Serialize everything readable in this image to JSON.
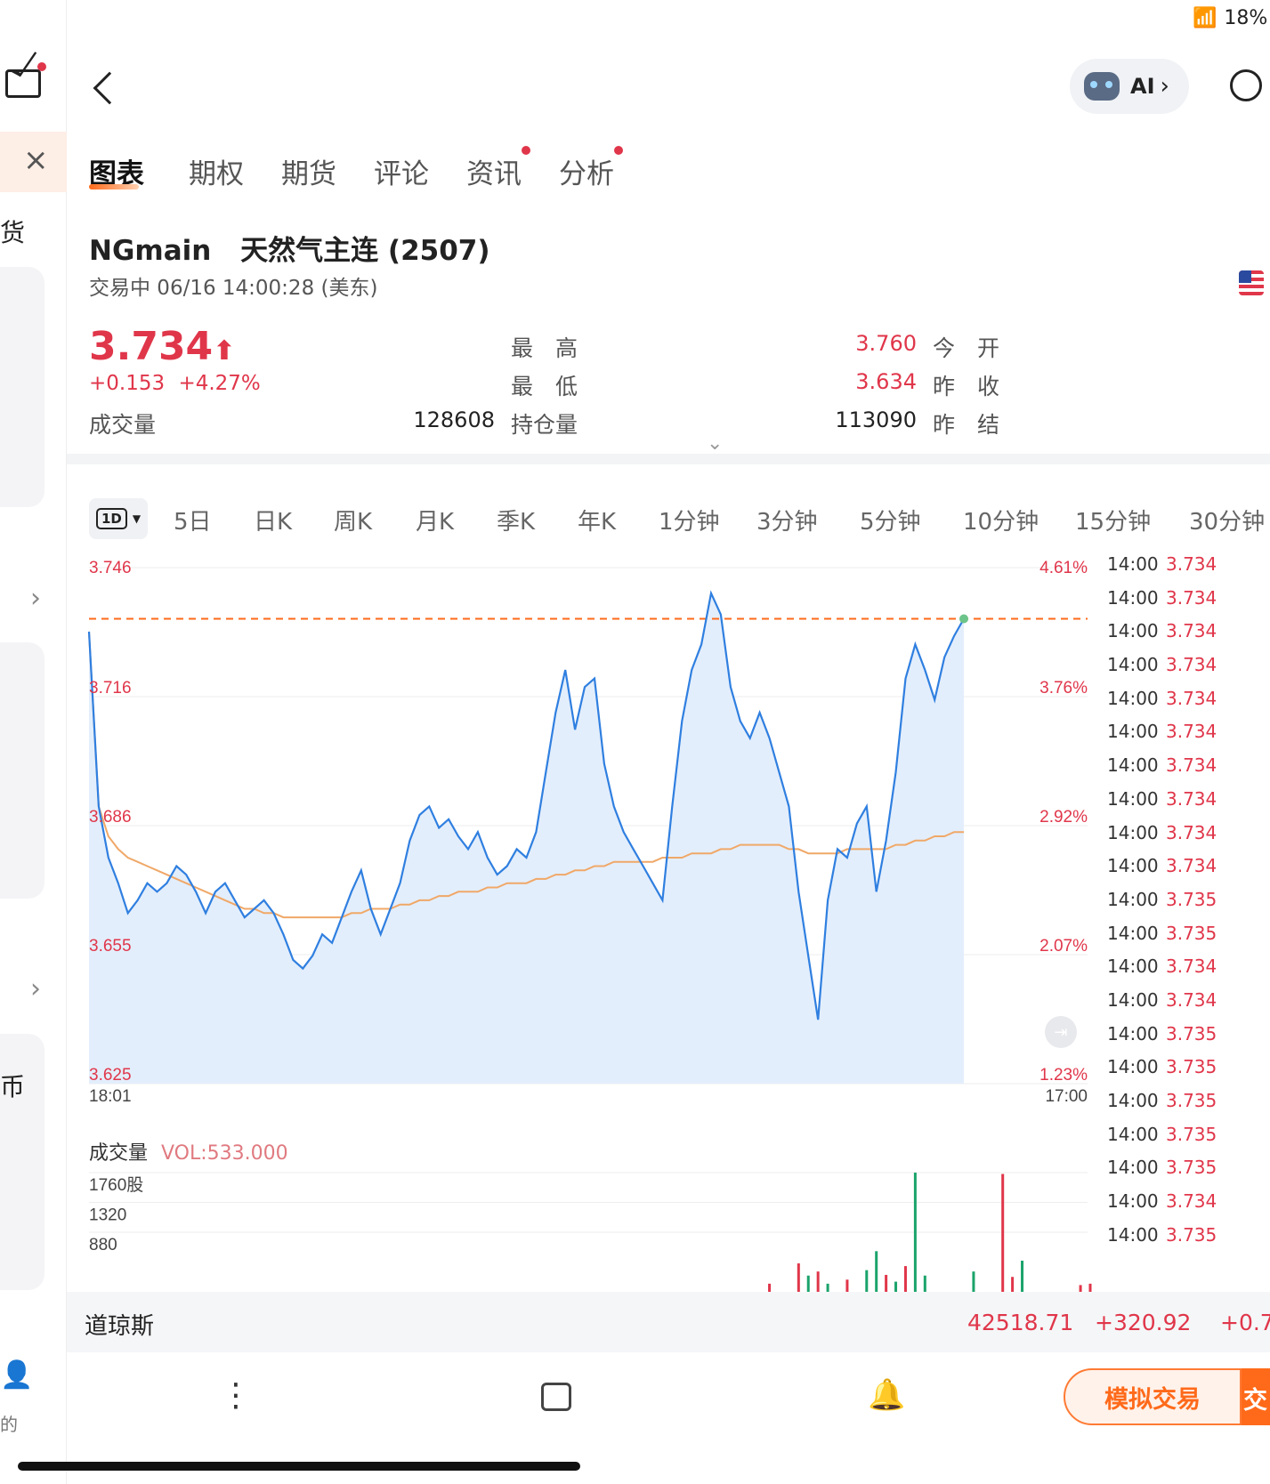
{
  "status": {
    "battery": "18%"
  },
  "left_rail": {
    "text1": "货",
    "text2": "币",
    "text3": "的"
  },
  "header": {
    "ai_label": "AI"
  },
  "tabs": [
    {
      "label": "图表",
      "active": true,
      "dot": false
    },
    {
      "label": "期权",
      "active": false,
      "dot": false
    },
    {
      "label": "期货",
      "active": false,
      "dot": false
    },
    {
      "label": "评论",
      "active": false,
      "dot": false
    },
    {
      "label": "资讯",
      "active": false,
      "dot": true
    },
    {
      "label": "分析",
      "active": false,
      "dot": true
    }
  ],
  "instrument": {
    "code": "NGmain",
    "name": "天然气主连 (2507)",
    "status": "交易中 06/16 14:00:28 (美东)"
  },
  "quote": {
    "price": "3.734",
    "change": "+0.153",
    "change_pct": "+4.27%",
    "high_label": "最　高",
    "high": "3.760",
    "open_label": "今　开",
    "low_label": "最　低",
    "low": "3.634",
    "prev_close_label": "昨　收",
    "volume_label": "成交量",
    "volume": "128608",
    "oi_label": "持仓量",
    "oi": "113090",
    "prev_settle_label": "昨　结"
  },
  "periods": [
    "5日",
    "日K",
    "周K",
    "月K",
    "季K",
    "年K",
    "1分钟",
    "3分钟",
    "5分钟",
    "10分钟",
    "15分钟",
    "30分钟"
  ],
  "period_selector": "1D",
  "chart_data": {
    "type": "line",
    "y_left_ticks": [
      "3.746",
      "3.716",
      "3.686",
      "3.655",
      "3.625"
    ],
    "y_right_ticks": [
      "4.61%",
      "3.76%",
      "2.92%",
      "2.07%",
      "1.23%"
    ],
    "x_ticks": [
      "18:01",
      "17:00"
    ],
    "ylim": [
      3.625,
      3.746
    ],
    "reference_price": 3.734,
    "series": [
      {
        "values": [
          3.731,
          3.69,
          3.678,
          3.672,
          3.665,
          3.668,
          3.672,
          3.67,
          3.672,
          3.676,
          3.674,
          3.67,
          3.665,
          3.67,
          3.672,
          3.668,
          3.664,
          3.666,
          3.668,
          3.665,
          3.66,
          3.654,
          3.652,
          3.655,
          3.66,
          3.658,
          3.664,
          3.67,
          3.675,
          3.666,
          3.66,
          3.666,
          3.672,
          3.682,
          3.688,
          3.69,
          3.685,
          3.687,
          3.683,
          3.68,
          3.684,
          3.678,
          3.674,
          3.676,
          3.68,
          3.678,
          3.684,
          3.698,
          3.712,
          3.722,
          3.708,
          3.718,
          3.72,
          3.7,
          3.69,
          3.684,
          3.68,
          3.676,
          3.672,
          3.668,
          3.69,
          3.71,
          3.722,
          3.728,
          3.74,
          3.735,
          3.718,
          3.71,
          3.706,
          3.712,
          3.706,
          3.698,
          3.69,
          3.67,
          3.655,
          3.64,
          3.668,
          3.68,
          3.678,
          3.686,
          3.69,
          3.67,
          3.682,
          3.698,
          3.72,
          3.728,
          3.722,
          3.715,
          3.725,
          3.73,
          3.734
        ]
      },
      {
        "values": [
          3.731,
          3.69,
          3.683,
          3.68,
          3.678,
          3.677,
          3.676,
          3.675,
          3.674,
          3.673,
          3.672,
          3.671,
          3.67,
          3.669,
          3.668,
          3.667,
          3.666,
          3.666,
          3.665,
          3.665,
          3.664,
          3.664,
          3.664,
          3.664,
          3.664,
          3.664,
          3.664,
          3.665,
          3.665,
          3.666,
          3.666,
          3.666,
          3.667,
          3.667,
          3.668,
          3.668,
          3.669,
          3.669,
          3.67,
          3.67,
          3.67,
          3.671,
          3.671,
          3.672,
          3.672,
          3.672,
          3.673,
          3.673,
          3.674,
          3.674,
          3.675,
          3.675,
          3.676,
          3.676,
          3.677,
          3.677,
          3.677,
          3.677,
          3.677,
          3.678,
          3.678,
          3.678,
          3.679,
          3.679,
          3.679,
          3.68,
          3.68,
          3.681,
          3.681,
          3.681,
          3.681,
          3.681,
          3.68,
          3.68,
          3.679,
          3.679,
          3.679,
          3.679,
          3.68,
          3.68,
          3.68,
          3.68,
          3.68,
          3.681,
          3.681,
          3.682,
          3.682,
          3.683,
          3.683,
          3.684,
          3.684
        ]
      }
    ]
  },
  "time_sales": {
    "rows": [
      {
        "t": "14:00",
        "p": "3.734"
      },
      {
        "t": "14:00",
        "p": "3.734"
      },
      {
        "t": "14:00",
        "p": "3.734"
      },
      {
        "t": "14:00",
        "p": "3.734"
      },
      {
        "t": "14:00",
        "p": "3.734"
      },
      {
        "t": "14:00",
        "p": "3.734"
      },
      {
        "t": "14:00",
        "p": "3.734"
      },
      {
        "t": "14:00",
        "p": "3.734"
      },
      {
        "t": "14:00",
        "p": "3.734"
      },
      {
        "t": "14:00",
        "p": "3.734"
      },
      {
        "t": "14:00",
        "p": "3.735"
      },
      {
        "t": "14:00",
        "p": "3.735"
      },
      {
        "t": "14:00",
        "p": "3.734"
      },
      {
        "t": "14:00",
        "p": "3.734"
      },
      {
        "t": "14:00",
        "p": "3.735"
      },
      {
        "t": "14:00",
        "p": "3.735"
      },
      {
        "t": "14:00",
        "p": "3.735"
      },
      {
        "t": "14:00",
        "p": "3.735"
      },
      {
        "t": "14:00",
        "p": "3.735"
      },
      {
        "t": "14:00",
        "p": "3.734"
      },
      {
        "t": "14:00",
        "p": "3.735"
      }
    ]
  },
  "volume_panel": {
    "label": "成交量",
    "vol_text": "VOL:533.000",
    "ticks": [
      "1760股",
      "1320",
      "880"
    ],
    "bars": [
      {
        "idx": 70,
        "v": 120,
        "up": false
      },
      {
        "idx": 73,
        "v": 420,
        "up": false
      },
      {
        "idx": 74,
        "v": 240,
        "up": true
      },
      {
        "idx": 75,
        "v": 300,
        "up": false
      },
      {
        "idx": 76,
        "v": 120,
        "up": true
      },
      {
        "idx": 78,
        "v": 180,
        "up": false
      },
      {
        "idx": 80,
        "v": 320,
        "up": true
      },
      {
        "idx": 81,
        "v": 600,
        "up": true
      },
      {
        "idx": 82,
        "v": 250,
        "up": false
      },
      {
        "idx": 83,
        "v": 150,
        "up": true
      },
      {
        "idx": 84,
        "v": 380,
        "up": false
      },
      {
        "idx": 85,
        "v": 1760,
        "up": true
      },
      {
        "idx": 86,
        "v": 240,
        "up": true
      },
      {
        "idx": 91,
        "v": 300,
        "up": true
      },
      {
        "idx": 94,
        "v": 1740,
        "up": false
      },
      {
        "idx": 95,
        "v": 220,
        "up": false
      },
      {
        "idx": 96,
        "v": 460,
        "up": true
      },
      {
        "idx": 102,
        "v": 100,
        "up": false
      },
      {
        "idx": 103,
        "v": 120,
        "up": false
      }
    ]
  },
  "index_bar": {
    "name": "道琼斯",
    "value": "42518.71",
    "change": "+320.92",
    "pct": "+0.7"
  },
  "bottom": {
    "paper_trade": "模拟交易",
    "trade": "交"
  },
  "colors": {
    "up": "#e0364a",
    "down": "#1ba36b",
    "line": "#2f7fe0",
    "avg": "#f0a868",
    "accent": "#ff6a1a"
  }
}
